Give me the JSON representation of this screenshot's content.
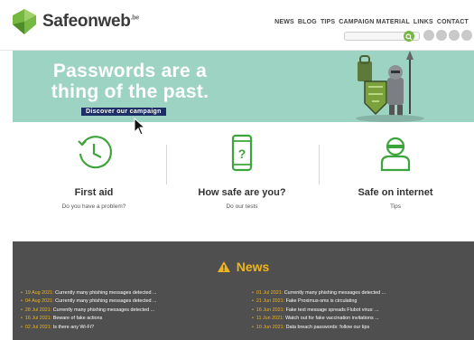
{
  "header": {
    "logo_text": "Safeonweb",
    "logo_sup": ".be",
    "nav": [
      "NEWS",
      "BLOG",
      "TIPS",
      "CAMPAIGN MATERIAL",
      "LINKS",
      "CONTACT"
    ],
    "search_placeholder": ""
  },
  "hero": {
    "title_line1": "Passwords are a",
    "title_line2": "thing of the past.",
    "button": "Discover our campaign"
  },
  "features": [
    {
      "title": "First aid",
      "subtitle": "Do you have a problem?",
      "icon": "clock-icon"
    },
    {
      "title": "How safe are you?",
      "subtitle": "Do our tests",
      "icon": "phone-question-icon"
    },
    {
      "title": "Safe on internet",
      "subtitle": "Tips",
      "icon": "user-mask-icon"
    }
  ],
  "news": {
    "title": "News",
    "left": [
      {
        "date": "19 Aug 2021:",
        "text": " Currently many phishing messages detected ..."
      },
      {
        "date": "04 Aug 2021:",
        "text": " Currently many phishing messages detected ..."
      },
      {
        "date": "28 Jul 2021:",
        "text": " Currently many phishing messages detected ..."
      },
      {
        "date": "16 Jul 2021:",
        "text": " Beware of fake actions"
      },
      {
        "date": "02 Jul 2021:",
        "text": " Is there any Wi-Fi?"
      }
    ],
    "right": [
      {
        "date": "01 Jul 2021:",
        "text": " Currently many phishing messages detected ..."
      },
      {
        "date": "21 Jun 2021:",
        "text": " Fake Proximus-sms is circulating"
      },
      {
        "date": "16 Jun 2021:",
        "text": " Fake text message spreads Flubot virus: ..."
      },
      {
        "date": "11 Jun 2021:",
        "text": " Watch out for fake vaccination invitations ..."
      },
      {
        "date": "10 Jun 2021:",
        "text": " Data breach passwords: follow our tips"
      }
    ]
  },
  "colors": {
    "brand_green": "#77b843",
    "hero_bg": "#9dd3c2",
    "hero_button": "#1e2f65",
    "news_bg": "#4f4f4f",
    "news_accent": "#f0b51c"
  }
}
